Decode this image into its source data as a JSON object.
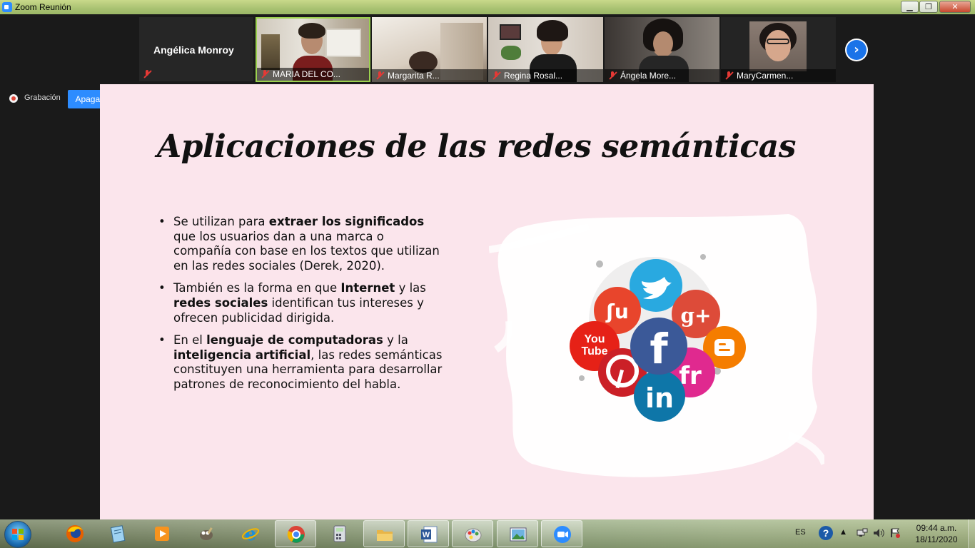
{
  "window": {
    "title": "Zoom Reunión",
    "minimize_glyph": "▁",
    "maximize_glyph": "❐",
    "close_glyph": "✕"
  },
  "meeting": {
    "active_speaker": "Angélica Monroy",
    "participants": [
      {
        "name": "MARIA DEL CO..."
      },
      {
        "name": "Margarita R..."
      },
      {
        "name": "Regina Rosal..."
      },
      {
        "name": "Ángela More..."
      },
      {
        "name": "MaryCarmen..."
      }
    ],
    "next_page_icon": "chevron-right-icon",
    "next_glyph": "›",
    "recording_label": "Grabación",
    "original_sound_button": "Apagar el sonido original",
    "dropdown_glyph": "▼",
    "highlight_color": "#9bd14f",
    "accent_color": "#2d8cff"
  },
  "slide": {
    "title": "Aplicaciones de las redes semánticas",
    "bullets": [
      {
        "parts": [
          {
            "t": "Se utilizan para ",
            "b": false
          },
          {
            "t": "extraer los significados",
            "b": true
          },
          {
            "t": " que los usuarios dan a una marca o compañía con base en los textos que utilizan en las redes sociales (Derek, 2020).",
            "b": false
          }
        ]
      },
      {
        "parts": [
          {
            "t": "También es la forma en que ",
            "b": false
          },
          {
            "t": "Internet",
            "b": true
          },
          {
            "t": " y las ",
            "b": false
          },
          {
            "t": "redes sociales",
            "b": true
          },
          {
            "t": " identifican tus intereses y ofrecen publicidad dirigida.",
            "b": false
          }
        ]
      },
      {
        "parts": [
          {
            "t": "En el ",
            "b": false
          },
          {
            "t": "lenguaje de computadoras",
            "b": true
          },
          {
            "t": " y la ",
            "b": false
          },
          {
            "t": "inteligencia artificial",
            "b": true
          },
          {
            "t": ", las redes semánticas constituyen una herramienta para desarrollar patrones de reconocimiento del habla.",
            "b": false
          }
        ]
      }
    ],
    "social_icons": [
      {
        "name": "twitter-icon",
        "color": "#29a9e0"
      },
      {
        "name": "stumbleupon-icon",
        "color": "#e8452c",
        "glyph": "ʃu"
      },
      {
        "name": "google-plus-icon",
        "color": "#dd4b39",
        "glyph": "g+"
      },
      {
        "name": "youtube-icon",
        "color": "#e62117",
        "glyph": "You Tube"
      },
      {
        "name": "facebook-icon",
        "color": "#3b5998",
        "glyph": "f"
      },
      {
        "name": "blogger-icon",
        "color": "#f57d00"
      },
      {
        "name": "pinterest-icon",
        "color": "#cb2027"
      },
      {
        "name": "friendfeed-icon",
        "color": "#e0298f",
        "glyph": "fr"
      },
      {
        "name": "linkedin-icon",
        "color": "#0e76a8",
        "glyph": "in"
      }
    ]
  },
  "taskbar": {
    "apps": [
      "firefox-icon",
      "notepad-icon",
      "media-player-icon",
      "gimp-icon",
      "internet-explorer-icon",
      "chrome-icon",
      "calculator-icon",
      "file-explorer-icon",
      "word-icon",
      "paint-icon",
      "photo-viewer-icon",
      "zoom-icon"
    ],
    "language": "ES",
    "help_glyph": "?",
    "tray_arrow": "▲",
    "time": "09:44 a.m.",
    "date": "18/11/2020"
  }
}
